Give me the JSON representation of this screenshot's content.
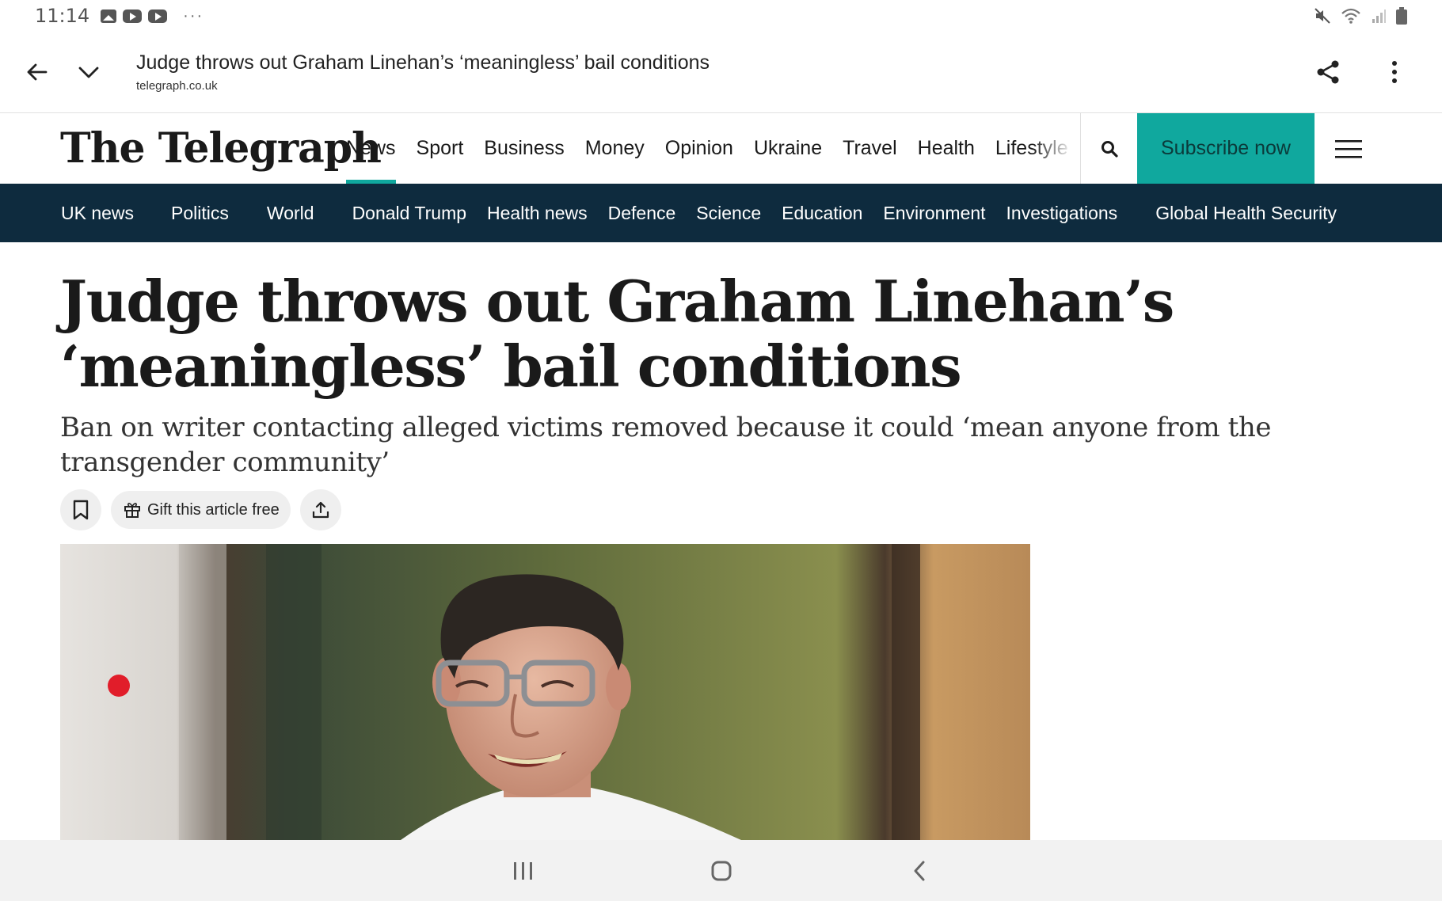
{
  "status_bar": {
    "time": "11:14",
    "notification_icons": [
      "gallery-icon",
      "youtube-icon",
      "youtube-icon"
    ],
    "more_indicator": "···",
    "system_icons": [
      "mute-icon",
      "wifi-icon",
      "signal-icon",
      "battery-icon"
    ]
  },
  "browser": {
    "page_title": "Judge throws out Graham Linehan’s ‘meaningless’ bail conditions",
    "domain": "telegraph.co.uk"
  },
  "site": {
    "logo": "The Telegraph",
    "nav": [
      "News",
      "Sport",
      "Business",
      "Money",
      "Opinion",
      "Ukraine",
      "Travel",
      "Health",
      "Lifestyle"
    ],
    "active_nav": "News",
    "subscribe_label": "Subscribe now",
    "accent_color": "#10a89e",
    "section_bar_color": "#0e2b3e"
  },
  "section_nav": [
    "UK news",
    "Politics",
    "World",
    "Donald Trump",
    "Health news",
    "Defence",
    "Science",
    "Education",
    "Environment",
    "Investigations",
    "Global Health Security"
  ],
  "article": {
    "headline": "Judge throws out Graham Linehan’s ‘meaningless’ bail conditions",
    "standfirst": "Ban on writer contacting alleged victims removed because it could ‘mean anyone from the transgender community’",
    "gift_label": "Gift this article free"
  }
}
